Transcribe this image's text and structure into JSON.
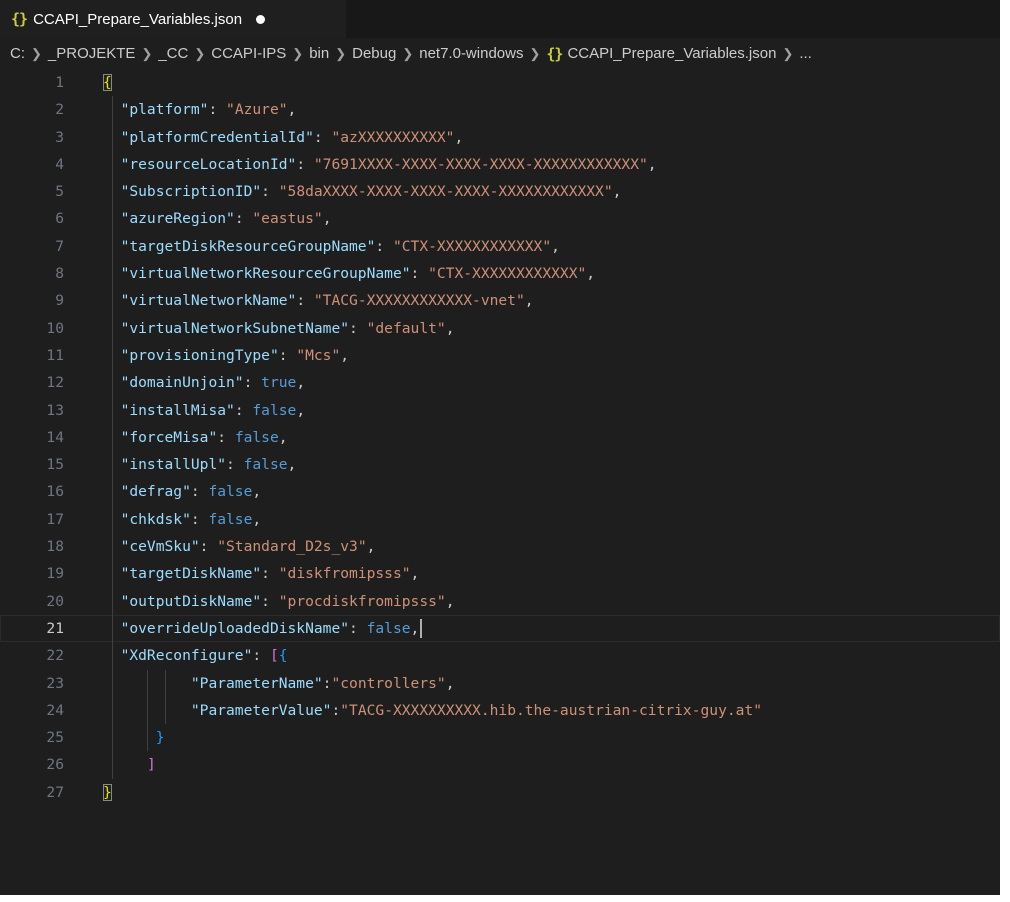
{
  "tab": {
    "icon": "{}",
    "title": "CCAPI_Prepare_Variables.json"
  },
  "breadcrumb": [
    "C:",
    "_PROJEKTE",
    "_CC",
    "CCAPI-IPS",
    "bin",
    "Debug",
    "net7.0-windows",
    "CCAPI_Prepare_Variables.json",
    "..."
  ],
  "breadcrumb_file_icon": "{}",
  "icons": {
    "tab_file": "json-file-icon",
    "breadcrumb_separator": "chevron-right-icon",
    "dirty": "unsaved-dot-icon"
  },
  "colors": {
    "editor_bg": "#1e1e1e",
    "key": "#9cdcfe",
    "string": "#ce9178",
    "boolean": "#569cd6",
    "bracket_level1": "#ffd700",
    "bracket_level2": "#da70d6",
    "bracket_level3": "#179fff"
  },
  "editor": {
    "current_line": 21,
    "lines": [
      {
        "n": "1",
        "open": "{"
      },
      {
        "n": "2",
        "key": "\"platform\"",
        "value": "\"Azure\"",
        "type": "string",
        "comma": ","
      },
      {
        "n": "3",
        "key": "\"platformCredentialId\"",
        "value": "\"azXXXXXXXXXX\"",
        "type": "string",
        "comma": ","
      },
      {
        "n": "4",
        "key": "\"resourceLocationId\"",
        "value": "\"7691XXXX-XXXX-XXXX-XXXX-XXXXXXXXXXXX\"",
        "type": "string",
        "comma": ","
      },
      {
        "n": "5",
        "key": "\"SubscriptionID\"",
        "value": "\"58daXXXX-XXXX-XXXX-XXXX-XXXXXXXXXXXX\"",
        "type": "string",
        "comma": ","
      },
      {
        "n": "6",
        "key": "\"azureRegion\"",
        "value": "\"eastus\"",
        "type": "string",
        "comma": ","
      },
      {
        "n": "7",
        "key": "\"targetDiskResourceGroupName\"",
        "value": "\"CTX-XXXXXXXXXXXX\"",
        "type": "string",
        "comma": ","
      },
      {
        "n": "8",
        "key": "\"virtualNetworkResourceGroupName\"",
        "value": "\"CTX-XXXXXXXXXXXX\"",
        "type": "string",
        "comma": ","
      },
      {
        "n": "9",
        "key": "\"virtualNetworkName\"",
        "value": "\"TACG-XXXXXXXXXXXX-vnet\"",
        "type": "string",
        "comma": ","
      },
      {
        "n": "10",
        "key": "\"virtualNetworkSubnetName\"",
        "value": "\"default\"",
        "type": "string",
        "comma": ","
      },
      {
        "n": "11",
        "key": "\"provisioningType\"",
        "value": "\"Mcs\"",
        "type": "string",
        "comma": ","
      },
      {
        "n": "12",
        "key": "\"domainUnjoin\"",
        "value": "true",
        "type": "bool",
        "comma": ","
      },
      {
        "n": "13",
        "key": "\"installMisa\"",
        "value": "false",
        "type": "bool",
        "comma": ","
      },
      {
        "n": "14",
        "key": "\"forceMisa\"",
        "value": "false",
        "type": "bool",
        "comma": ","
      },
      {
        "n": "15",
        "key": "\"installUpl\"",
        "value": "false",
        "type": "bool",
        "comma": ","
      },
      {
        "n": "16",
        "key": "\"defrag\"",
        "value": "false",
        "type": "bool",
        "comma": ","
      },
      {
        "n": "17",
        "key": "\"chkdsk\"",
        "value": "false",
        "type": "bool",
        "comma": ","
      },
      {
        "n": "18",
        "key": "\"ceVmSku\"",
        "value": "\"Standard_D2s_v3\"",
        "type": "string",
        "comma": ","
      },
      {
        "n": "19",
        "key": "\"targetDiskName\"",
        "value": "\"diskfromipsss\"",
        "type": "string",
        "comma": ","
      },
      {
        "n": "20",
        "key": "\"outputDiskName\"",
        "value": "\"procdiskfromipsss\"",
        "type": "string",
        "comma": ","
      },
      {
        "n": "21",
        "key": "\"overrideUploadedDiskName\"",
        "value": "false",
        "type": "bool",
        "comma": ","
      },
      {
        "n": "22",
        "key": "\"XdReconfigure\"",
        "array_open": "[",
        "obj_open": "{"
      },
      {
        "n": "23",
        "key": "\"ParameterName\"",
        "value": "\"controllers\"",
        "type": "string",
        "comma": ",",
        "tight": true
      },
      {
        "n": "24",
        "key": "\"ParameterValue\"",
        "value": "\"TACG-XXXXXXXXXX.hib.the-austrian-citrix-guy.at\"",
        "type": "string",
        "comma": "",
        "tight": true
      },
      {
        "n": "25",
        "obj_close": "}"
      },
      {
        "n": "26",
        "array_close": "]"
      },
      {
        "n": "27",
        "close": "}"
      }
    ]
  }
}
